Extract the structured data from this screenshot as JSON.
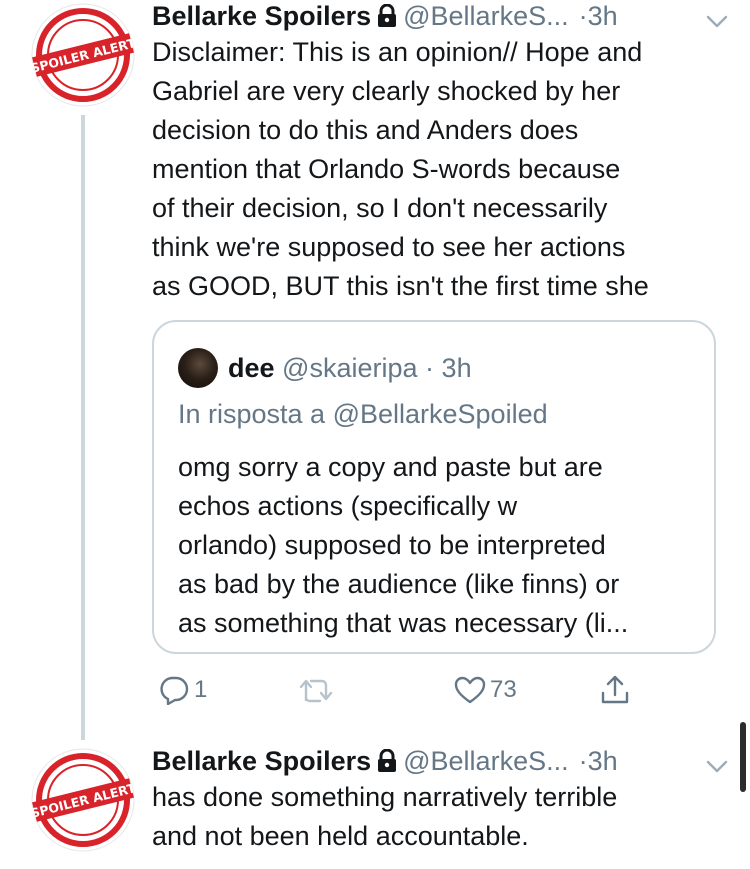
{
  "tweets": [
    {
      "avatar_text": "SPOILER ALERT",
      "name": "Bellarke Spoilers",
      "handle": "@BellarkeS...",
      "dot": "·",
      "time": "3h",
      "text": "Disclaimer: This is an opinion// Hope and\nGabriel are very clearly shocked by her\ndecision to do this and Anders does\nmention that Orlando S-words because\nof their decision, so I don't necessarily\nthink we're supposed to see her actions\nas GOOD, BUT this isn't the first time she",
      "quote": {
        "name": "dee",
        "handle": "@skaieripa",
        "dot": "·",
        "time": "3h",
        "reply_to": "In risposta a @BellarkeSpoiled",
        "text": "omg sorry a copy and paste but are\nechos actions (specifically w\norlando) supposed to be interpreted\nas bad by the audience (like finns) or\nas something that was necessary (li..."
      },
      "actions": {
        "reply_count": "1",
        "retweet_count": "",
        "like_count": "73"
      }
    },
    {
      "avatar_text": "SPOILER ALERT",
      "name": "Bellarke Spoilers",
      "handle": "@BellarkeS...",
      "dot": "·",
      "time": "3h",
      "text": "has done something narratively terrible\nand not been held accountable."
    }
  ],
  "colors": {
    "primary_text": "#14171a",
    "secondary_text": "#657786",
    "border": "#ccd6dd",
    "stamp_red": "#d8232a"
  },
  "icons": {
    "lock": "lock-icon",
    "chevron": "chevron-down-icon",
    "reply": "reply-icon",
    "retweet": "retweet-icon",
    "like": "heart-icon",
    "share": "share-icon"
  }
}
